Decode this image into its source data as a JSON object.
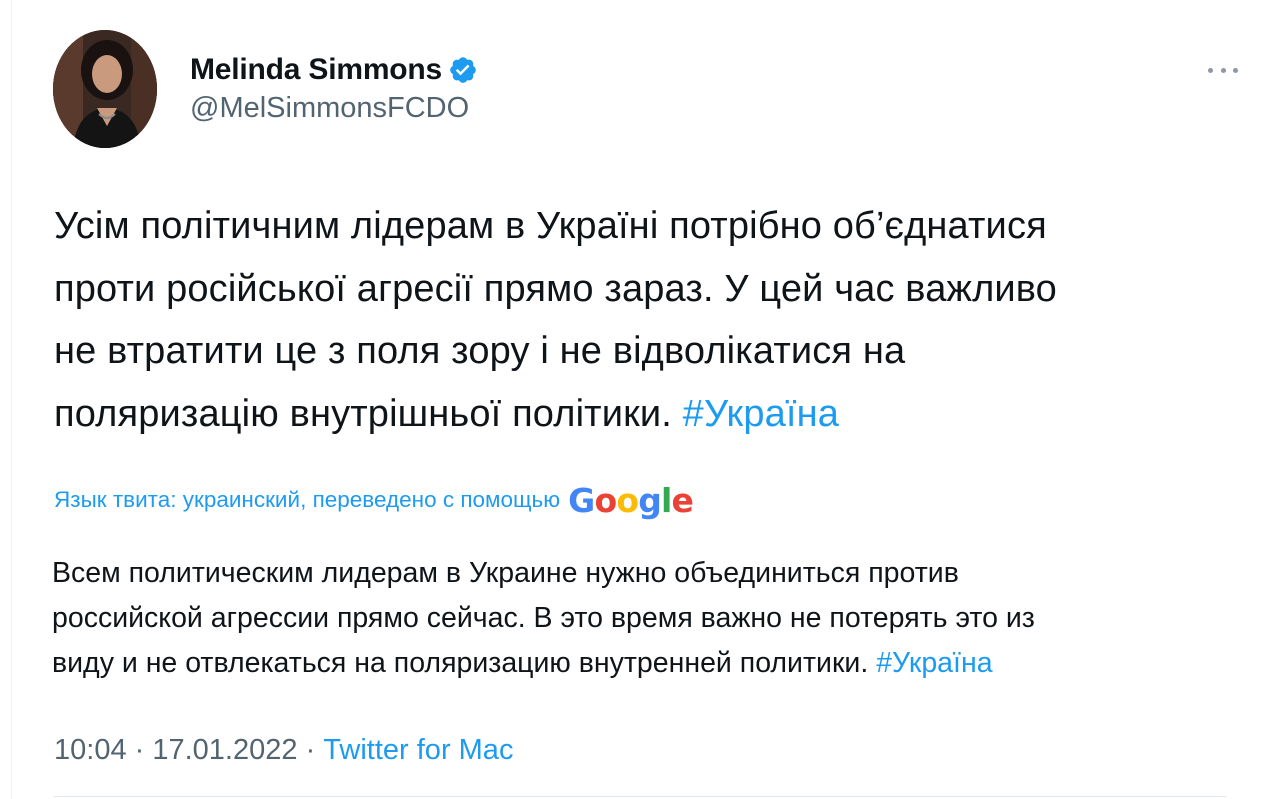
{
  "author": {
    "name": "Melinda Simmons",
    "handle": "@MelSimmonsFCDO",
    "verified": true
  },
  "tweet": {
    "text_parts": [
      "Усім політичним лідерам в Україні потрібно об’єднатися",
      "проти російської агресії прямо зараз. У цей час важливо",
      "не втратити це з поля зору і не відволікатися на",
      "поляризацію внутрішньої політики. "
    ],
    "hashtag": "#Україна"
  },
  "translation": {
    "notice": "Язык твита: украинский, переведено с помощью",
    "provider": "Google",
    "text_parts": [
      "Всем политическим лидерам в Украине нужно объединиться против",
      "российской агрессии прямо сейчас. В это время важно не потерять это из",
      "виду и не отвлекаться на поляризацию внутренней политики. "
    ],
    "hashtag": "#Україна"
  },
  "meta": {
    "time": "10:04",
    "separator": " · ",
    "date": "17.01.2022",
    "source": "Twitter for Mac"
  },
  "colors": {
    "link": "#1d9bf0",
    "secondary": "#536471",
    "primary": "#0f1419"
  }
}
